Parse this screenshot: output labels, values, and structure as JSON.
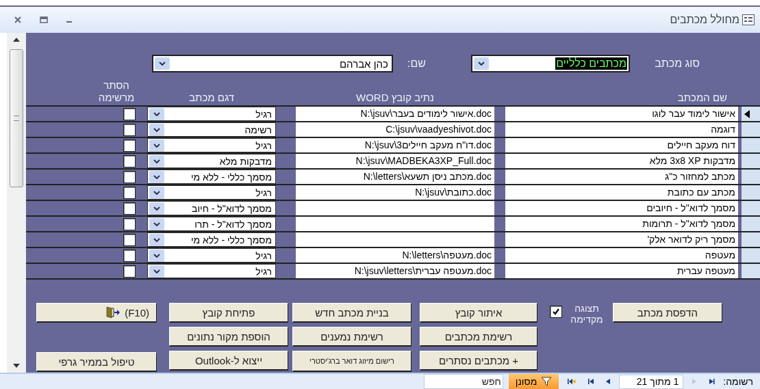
{
  "window": {
    "title": "מחולל מכתבים"
  },
  "filters": {
    "letter_type": {
      "label": "סוג מכתב",
      "value": "מכתבים כלליים"
    },
    "name": {
      "label": "שם:",
      "value": "כהן אברהם"
    }
  },
  "table": {
    "columns": [
      "שם המכתב",
      "נתיב קובץ WORD",
      "דגם מכתב",
      "הסתר מרשימה"
    ],
    "rows": [
      {
        "name": "אישור לימוד עבר לוגו",
        "path": "N:\\jsuv\\אישור לימודים בעבר.doc",
        "type": "רגיל",
        "hidden": false,
        "current": true
      },
      {
        "name": "דוגמה",
        "path": "C:\\jsuv\\vaadyeshivot.doc",
        "type": "רשימה",
        "hidden": false,
        "current": false
      },
      {
        "name": "דוח מעקב חיילים",
        "path": "N:\\jsuv\\3דו\"ח מעקב חיילים.doc",
        "type": "רגיל",
        "hidden": false,
        "current": false
      },
      {
        "name": "מדבקות 3x8 XP מלא",
        "path": "N:\\jsuv\\MADBEKA3XP_Full.doc",
        "type": "מדבקות מלא",
        "hidden": false,
        "current": false
      },
      {
        "name": "מכתב למחזור כ\"ג",
        "path": "N:\\letters\\מכתב ניסן תשעא.doc",
        "type": "מסמך כללי - ללא מי",
        "hidden": false,
        "current": false
      },
      {
        "name": "מכתב עם כתובת",
        "path": "N:\\jsuv\\כתובת.doc",
        "type": "רגיל",
        "hidden": false,
        "current": false
      },
      {
        "name": "מסמך לדוא\"ל - חיובים",
        "path": "",
        "type": "מסמך לדוא\"ל - חיוב",
        "hidden": false,
        "current": false
      },
      {
        "name": "מסמך לדוא\"ל - תרומות",
        "path": "",
        "type": "מסמך לדוא\"ל - תרו",
        "hidden": false,
        "current": false
      },
      {
        "name": "מסמך ריק לדואר אלק'",
        "path": "",
        "type": "מסמך כללי - ללא מי",
        "hidden": false,
        "current": false
      },
      {
        "name": "מעטפה",
        "path": "N:\\letters\\מעטפה.doc",
        "type": "רגיל",
        "hidden": false,
        "current": false
      },
      {
        "name": "מעטפה עברית",
        "path": "N:\\jsuv\\letters\\מעטפה עברית.doc",
        "type": "רגיל",
        "hidden": false,
        "current": false
      }
    ]
  },
  "preview": {
    "label": "תצוגה מקדימה",
    "checked": true
  },
  "button_columns": [
    [
      {
        "kind": "text",
        "label": "הדפסת מכתב"
      }
    ],
    [
      {
        "kind": "text",
        "label": "איתור קובץ"
      },
      {
        "kind": "text",
        "label": "רשימת מכתבים"
      },
      {
        "kind": "text",
        "label": "+ מכתבים נסתרים"
      }
    ],
    [
      {
        "kind": "text",
        "label": "בניית מכתב חדש"
      },
      {
        "kind": "text",
        "label": "רשימת נמענים"
      },
      {
        "kind": "small",
        "label": "רישום מיזוג דואר ברג'יסטרי"
      }
    ],
    [
      {
        "kind": "text",
        "label": "פתיחת קובץ"
      },
      {
        "kind": "text",
        "label": "הוספת מקור נתונים"
      },
      {
        "kind": "text",
        "label": "ייצוא ל-Outlook"
      }
    ],
    [
      {
        "kind": "exit",
        "label": "(F10)"
      },
      {
        "kind": "spacer"
      },
      {
        "kind": "text",
        "label": "טיפול בממיר גרפי"
      }
    ]
  ],
  "status_bar": {
    "record_label": "רשומה:",
    "position": "1 מתוך 21",
    "filter": "מסונן",
    "search_placeholder": "חפש"
  }
}
